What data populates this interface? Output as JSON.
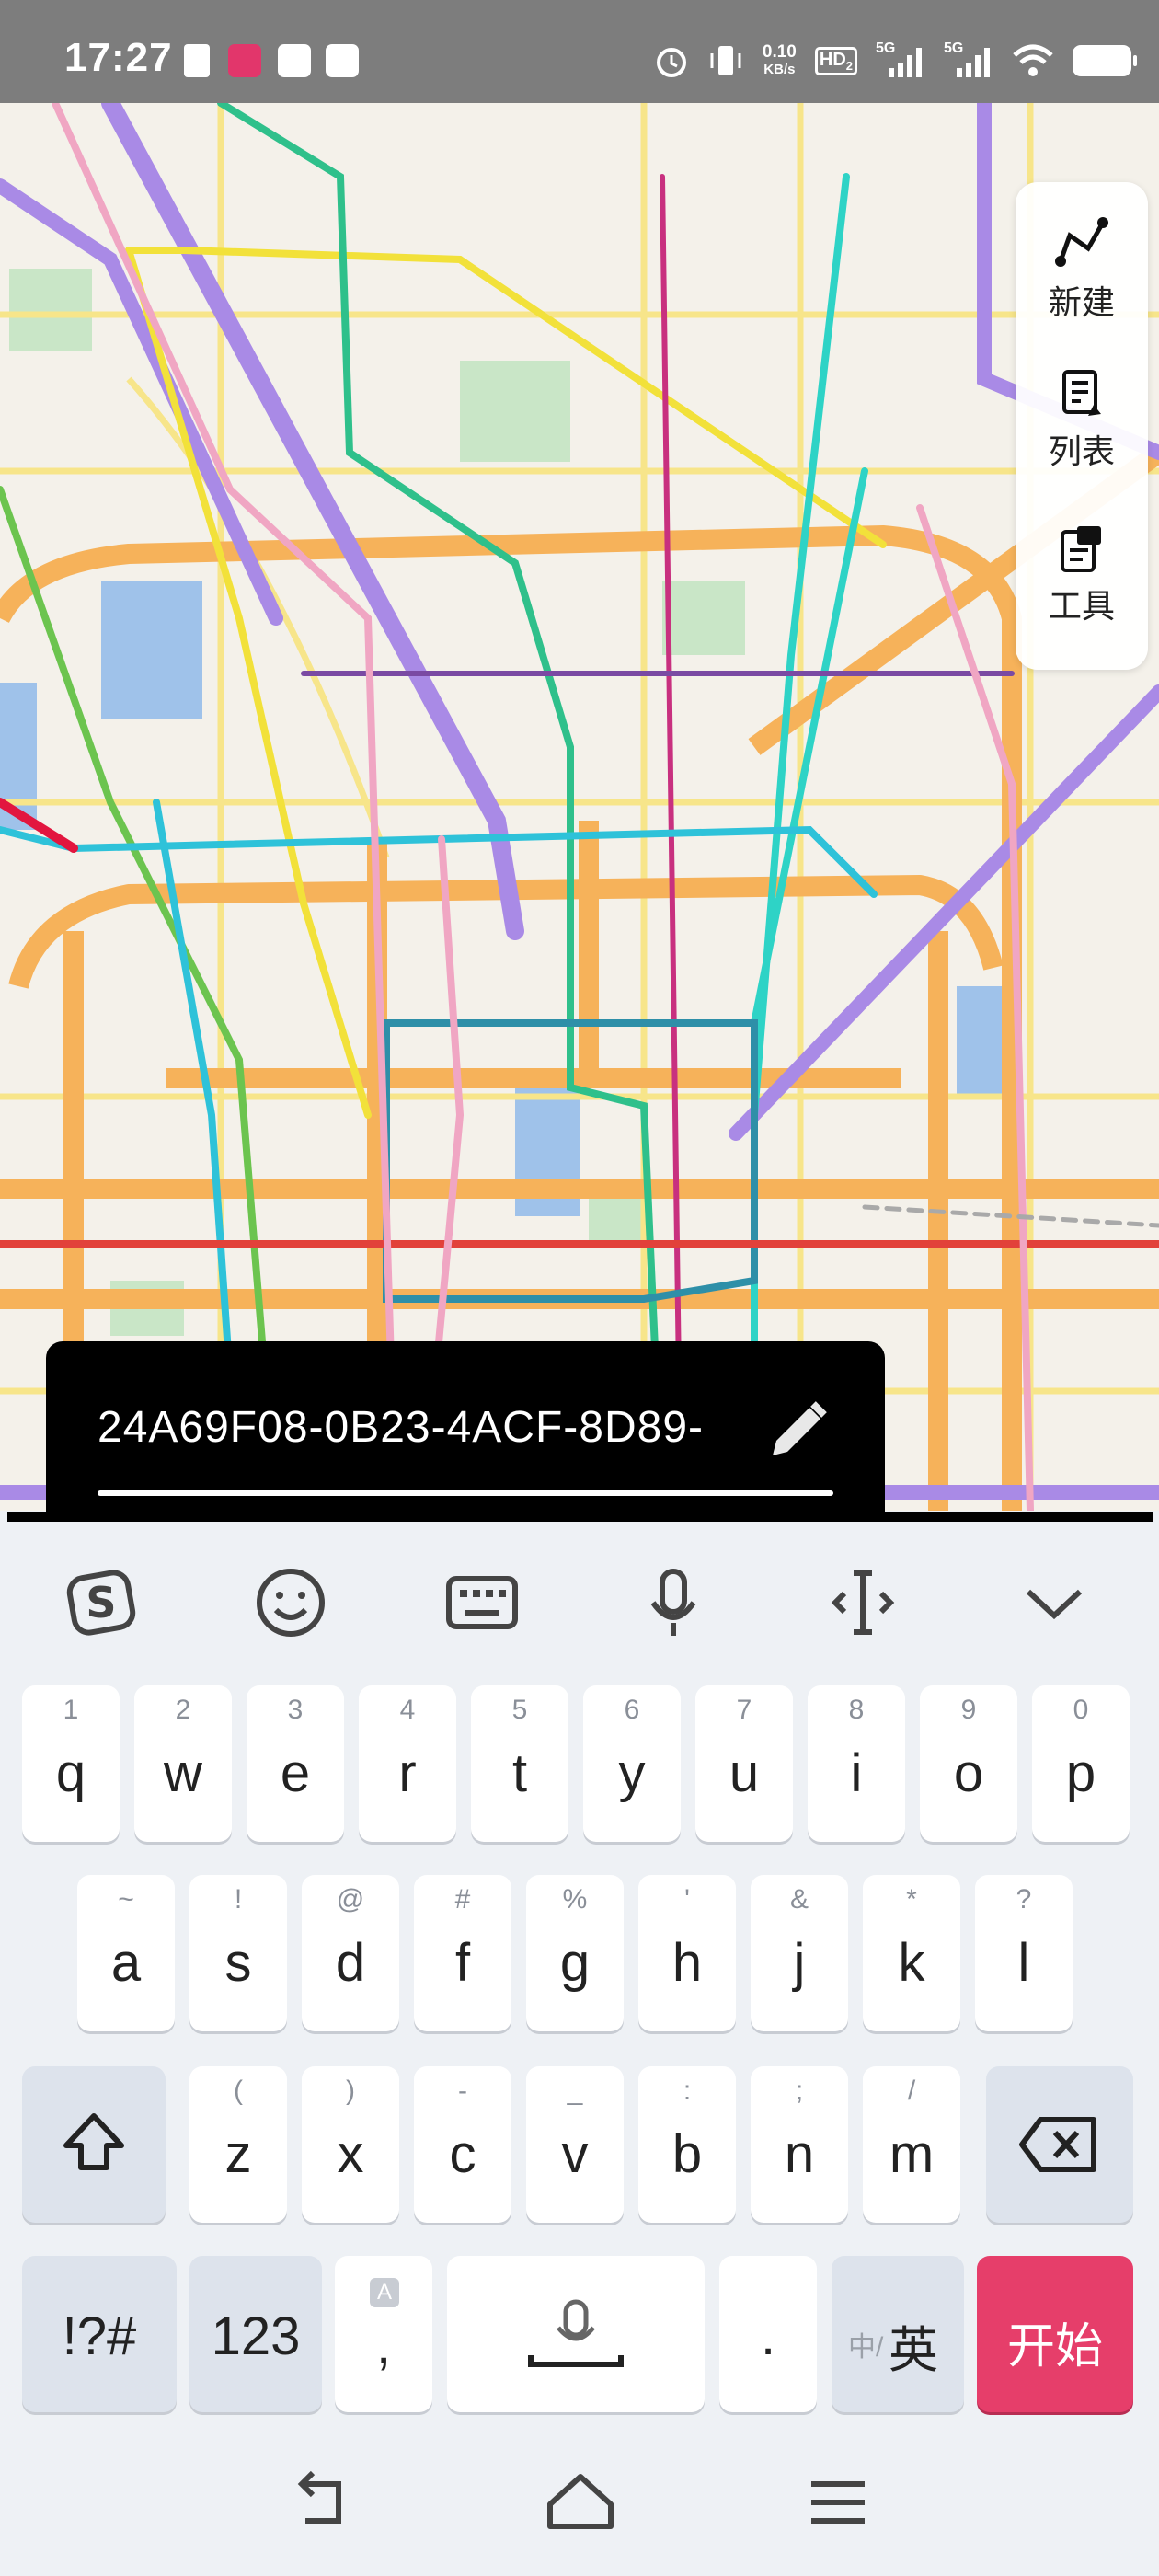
{
  "status_bar": {
    "time": "17:27",
    "net_speed_value": "0.10",
    "net_speed_unit": "KB/s",
    "hd_label": "HD",
    "hd_sub": "2",
    "sig1_label": "5G",
    "sig2_label": "5G"
  },
  "side_panel": {
    "new_label": "新建",
    "list_label": "列表",
    "tools_label": "工具"
  },
  "id_banner": {
    "value": "24A69F08-0B23-4ACF-8D89-"
  },
  "keyboard": {
    "toolbar": [
      "sogou-logo-icon",
      "emoji-icon",
      "keyboard-icon",
      "microphone-icon",
      "cursor-icon",
      "collapse-icon"
    ],
    "row1": [
      {
        "sub": "1",
        "main": "q"
      },
      {
        "sub": "2",
        "main": "w"
      },
      {
        "sub": "3",
        "main": "e"
      },
      {
        "sub": "4",
        "main": "r"
      },
      {
        "sub": "5",
        "main": "t"
      },
      {
        "sub": "6",
        "main": "y"
      },
      {
        "sub": "7",
        "main": "u"
      },
      {
        "sub": "8",
        "main": "i"
      },
      {
        "sub": "9",
        "main": "o"
      },
      {
        "sub": "0",
        "main": "p"
      }
    ],
    "row2": [
      {
        "sub": "~",
        "main": "a"
      },
      {
        "sub": "!",
        "main": "s"
      },
      {
        "sub": "@",
        "main": "d"
      },
      {
        "sub": "#",
        "main": "f"
      },
      {
        "sub": "%",
        "main": "g"
      },
      {
        "sub": "'",
        "main": "h"
      },
      {
        "sub": "&",
        "main": "j"
      },
      {
        "sub": "*",
        "main": "k"
      },
      {
        "sub": "?",
        "main": "l"
      }
    ],
    "row3": [
      {
        "sub": "(",
        "main": "z"
      },
      {
        "sub": ")",
        "main": "x"
      },
      {
        "sub": "-",
        "main": "c"
      },
      {
        "sub": "_",
        "main": "v"
      },
      {
        "sub": ":",
        "main": "b"
      },
      {
        "sub": ";",
        "main": "n"
      },
      {
        "sub": "/",
        "main": "m"
      }
    ],
    "symbols_label": "!?#",
    "numbers_label": "123",
    "comma_sub": "A",
    "comma_label": ",",
    "period_label": ".",
    "lang_small": "中/",
    "lang_main": "英",
    "start_label": "开始"
  },
  "colors": {
    "start_key": "#e63e6a",
    "map_road_major": "#f6b25a",
    "map_road_minor": "#f7e58a",
    "map_background": "#f4f1ea"
  }
}
